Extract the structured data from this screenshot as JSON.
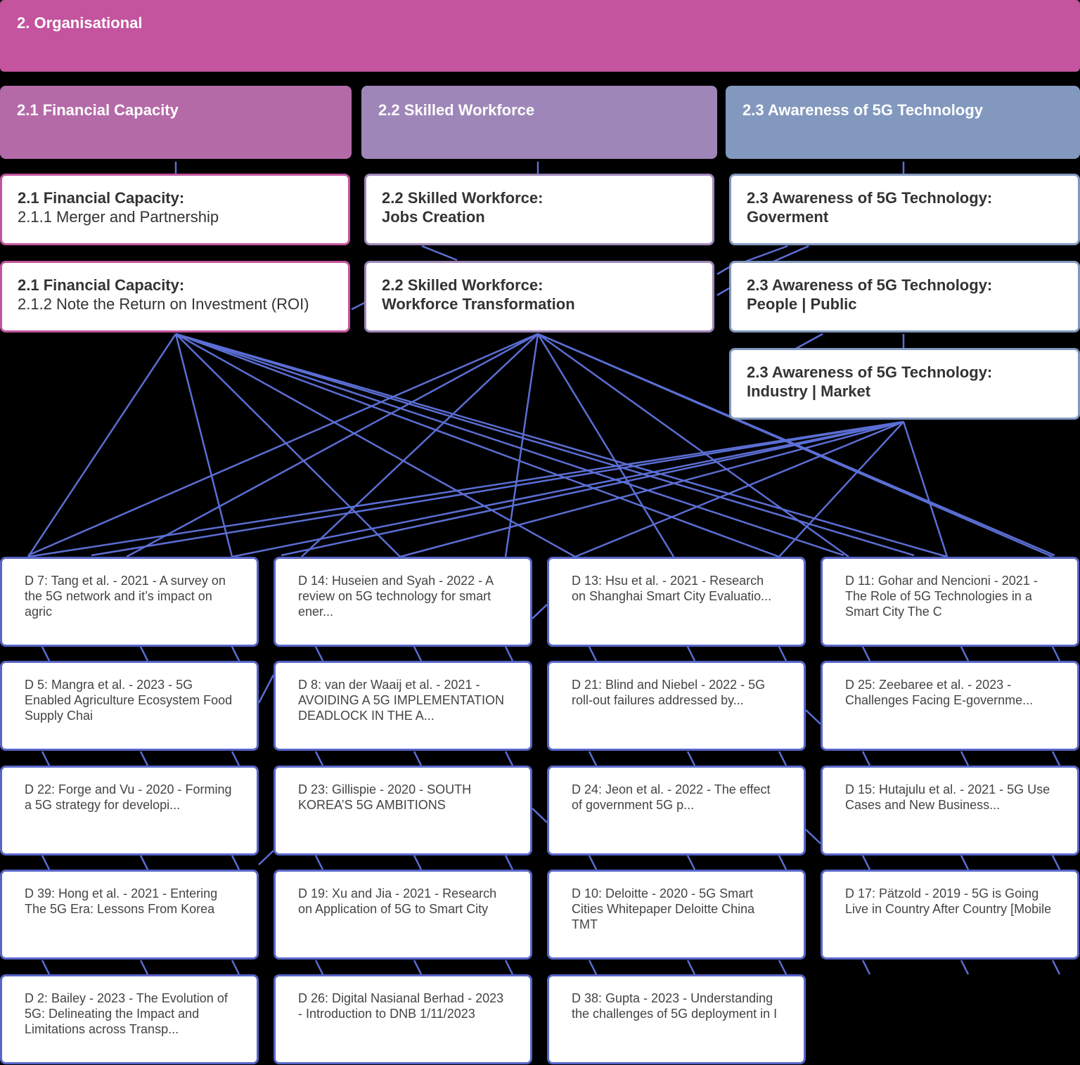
{
  "header": {
    "title": "2. Organisational"
  },
  "categories": [
    {
      "label": "2.1 Financial Capacity",
      "color": "#b56aa8"
    },
    {
      "label": "2.2 Skilled Workforce",
      "color": "#9e87b8"
    },
    {
      "label": "2.3 Awareness of 5G Technology",
      "color": "#8298bf"
    }
  ],
  "subnodes": {
    "fc1": {
      "title": "2.1 Financial Capacity:",
      "subtitle": "2.1.1 Merger and Partnership"
    },
    "fc2": {
      "title": "2.1 Financial Capacity:",
      "subtitle": "2.1.2 Note the Return on Investment (ROI)"
    },
    "sw1": {
      "title": "2.2 Skilled Workforce:",
      "subtitle": "Jobs Creation"
    },
    "sw2": {
      "title": "2.2 Skilled Workforce:",
      "subtitle": "Workforce Transformation"
    },
    "aw1": {
      "title": "2.3 Awareness of 5G Technology:",
      "subtitle": "Goverment"
    },
    "aw2": {
      "title": "2.3 Awareness of 5G Technology:",
      "subtitle": "People | Public"
    },
    "aw3": {
      "title": "2.3 Awareness of 5G Technology:",
      "subtitle": "Industry | Market"
    }
  },
  "documents": [
    "D 7: Tang et al. - 2021 - A survey on the 5G network and it’s impact on agric",
    "D 14: Huseien and Syah - 2022 - A review on 5G technology for smart ener...",
    "D 13: Hsu et al. - 2021 - Research on Shanghai Smart City Evaluatio...",
    "D 11: Gohar and Nencioni - 2021 - The Role of 5G Technologies in a Smart City The C",
    "D 5: Mangra et al. - 2023 - 5G Enabled Agriculture Ecosystem Food Supply Chai",
    "D 8: van der Waaij et al. - 2021 - AVOIDING A 5G IMPLEMENTATION DEADLOCK IN THE A...",
    "D 21: Blind and Niebel - 2022 - 5G roll-out failures addressed by...",
    "D 25: Zeebaree et al. - 2023 - Challenges Facing E-governme...",
    "D 22: Forge and Vu - 2020 - Forming a 5G strategy for developi...",
    "D 23: Gillispie - 2020 - SOUTH KOREA’S 5G AMBITIONS",
    "D 24: Jeon et al. - 2022 - The effect of government 5G p...",
    "D 15: Hutajulu et al. - 2021 - 5G Use Cases and New Business...",
    "D 39: Hong et al. - 2021 - Entering The 5G Era: Lessons From Korea",
    "D 19: Xu and Jia - 2021 - Research on Application of 5G to Smart City",
    "D 10: Deloitte - 2020 - 5G Smart Cities Whitepaper Deloitte China TMT",
    "D 17: Pätzold - 2019 - 5G is Going Live in Country After Country [Mobile",
    "D 2: Bailey - 2023 - The Evolution of 5G: Delineating the Impact and Limitations across Transp...",
    "D 26: Digital Nasianal Berhad - 2023 - Introduction to DNB 1/11/2023",
    "D 38: Gupta - 2023 - Understanding the challenges of 5G deployment in I"
  ],
  "colors": {
    "link": "#5b6ed4",
    "border_fc": "#c3549d",
    "border_sw": "#9e87b8",
    "border_aw": "#8298bf"
  }
}
